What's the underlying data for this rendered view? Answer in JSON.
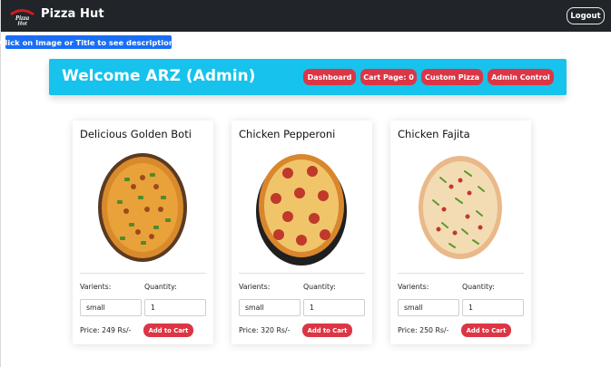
{
  "navbar": {
    "brand": "Pizza Hut",
    "logo_icon": "pizza-hut-logo-icon",
    "logout_label": "Logout"
  },
  "hint": {
    "label": "Click on Image or Title to see description!"
  },
  "welcome": {
    "title": "Welcome ARZ (Admin)",
    "buttons": [
      "Dashboard",
      "Cart Page: 0",
      "Custom Pizza",
      "Admin Control"
    ]
  },
  "labels": {
    "variants": "Varients:",
    "quantity": "Quantity:"
  },
  "products": [
    {
      "name": "Delicious Golden Boti",
      "variant": "small",
      "quantity": "1",
      "price": "Price: 249 Rs/-",
      "add_label": "Add to Cart",
      "image_icon": "golden-boti-pizza-icon"
    },
    {
      "name": "Chicken Pepperoni",
      "variant": "small",
      "quantity": "1",
      "price": "Price: 320 Rs/-",
      "add_label": "Add to Cart",
      "image_icon": "pepperoni-pizza-icon"
    },
    {
      "name": "Chicken Fajita",
      "variant": "small",
      "quantity": "1",
      "price": "Price: 250 Rs/-",
      "add_label": "Add to Cart",
      "image_icon": "fajita-pizza-icon"
    }
  ],
  "colors": {
    "navbar": "#212529",
    "accent_blue": "#1a6ef5",
    "welcome_bg": "#17c2ec",
    "button_red": "#dc3545"
  }
}
